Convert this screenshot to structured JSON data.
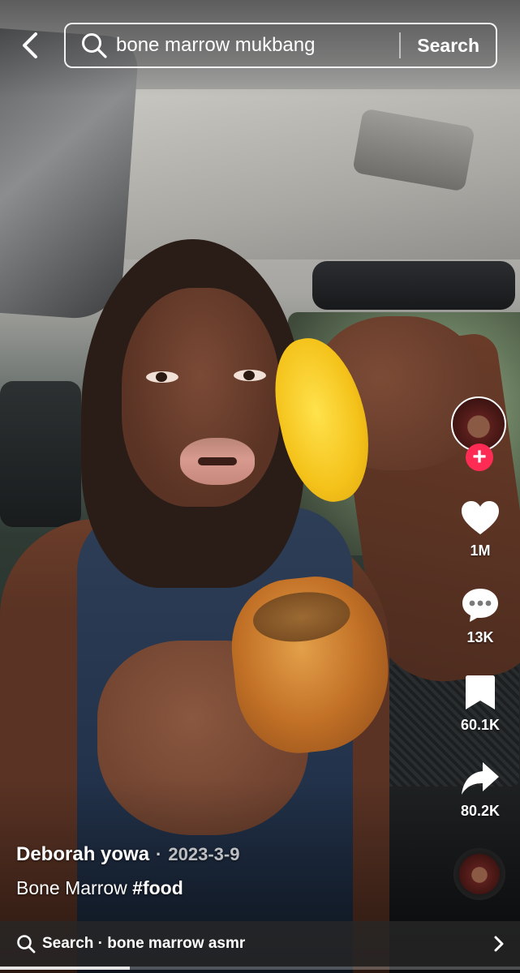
{
  "search": {
    "query": "bone marrow mukbang",
    "button_label": "Search"
  },
  "icons": {
    "back": "back-chevron-icon",
    "search": "search-icon",
    "like": "heart-icon",
    "comment": "comment-icon",
    "save": "bookmark-icon",
    "share": "share-arrow-icon",
    "follow": "plus-icon",
    "related_chevron": "chevron-right-icon"
  },
  "rail": {
    "follow_symbol": "+",
    "likes": "1M",
    "comments": "13K",
    "saves": "60.1K",
    "shares": "80.2K"
  },
  "post": {
    "author": "Deborah yowa",
    "separator": "·",
    "date": "2023-3-9",
    "description": "Bone Marrow",
    "hashtag": "#food"
  },
  "related_search": {
    "label": "Search · bone marrow asmr"
  },
  "playback": {
    "progress": 0.25
  },
  "colors": {
    "follow_badge": "#fe2c55",
    "text": "#ffffff"
  }
}
